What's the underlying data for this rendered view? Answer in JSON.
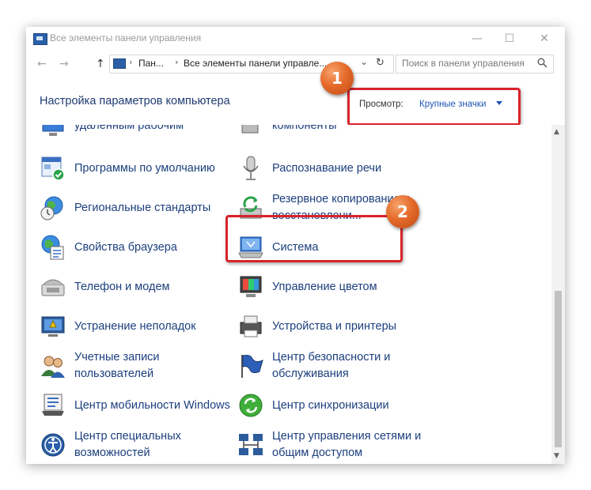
{
  "window": {
    "title": "Все элементы панели управления",
    "minimize": "—",
    "maximize": "☐",
    "close": "✕"
  },
  "nav": {
    "back": "←",
    "forward": "→",
    "up": "↑",
    "address_segments": [
      "Пан...",
      "Все элементы панели управле..."
    ],
    "refresh": "↻",
    "dropdown": "⌄",
    "search_placeholder": "Поиск в панели управления"
  },
  "header": {
    "title": "Настройка параметров компьютера",
    "view_label": "Просмотр:",
    "view_value": "Крупные значки"
  },
  "badges": [
    "1",
    "2"
  ],
  "items_left": [
    {
      "label": "удалённым рабочим",
      "icon": "remote-desktop-icon"
    },
    {
      "label": "Программы по умолчанию",
      "icon": "default-programs-icon"
    },
    {
      "label": "Региональные стандарты",
      "icon": "region-icon"
    },
    {
      "label": "Свойства браузера",
      "icon": "internet-options-icon"
    },
    {
      "label": "Телефон и модем",
      "icon": "phone-modem-icon"
    },
    {
      "label": "Устранение неполадок",
      "icon": "troubleshooting-icon"
    },
    {
      "label": "Учетные записи пользователей",
      "icon": "user-accounts-icon"
    },
    {
      "label": "Центр мобильности Windows",
      "icon": "mobility-center-icon"
    },
    {
      "label": "Центр специальных возможностей",
      "icon": "ease-of-access-icon"
    }
  ],
  "items_right": [
    {
      "label": "компоненты",
      "icon": "programs-features-icon"
    },
    {
      "label": "Распознавание речи",
      "icon": "speech-recognition-icon"
    },
    {
      "label": "Резервное копирование и восстановлени...",
      "icon": "backup-restore-icon"
    },
    {
      "label": "Система",
      "icon": "system-icon"
    },
    {
      "label": "Управление цветом",
      "icon": "color-management-icon"
    },
    {
      "label": "Устройства и принтеры",
      "icon": "devices-printers-icon"
    },
    {
      "label": "Центр безопасности и обслуживания",
      "icon": "security-maintenance-icon"
    },
    {
      "label": "Центр синхронизации",
      "icon": "sync-center-icon"
    },
    {
      "label": "Центр управления сетями и общим доступом",
      "icon": "network-sharing-icon"
    }
  ],
  "colors": {
    "link": "#1c3f7d",
    "highlight": "#d9232c",
    "badge": "#e56b2b"
  }
}
